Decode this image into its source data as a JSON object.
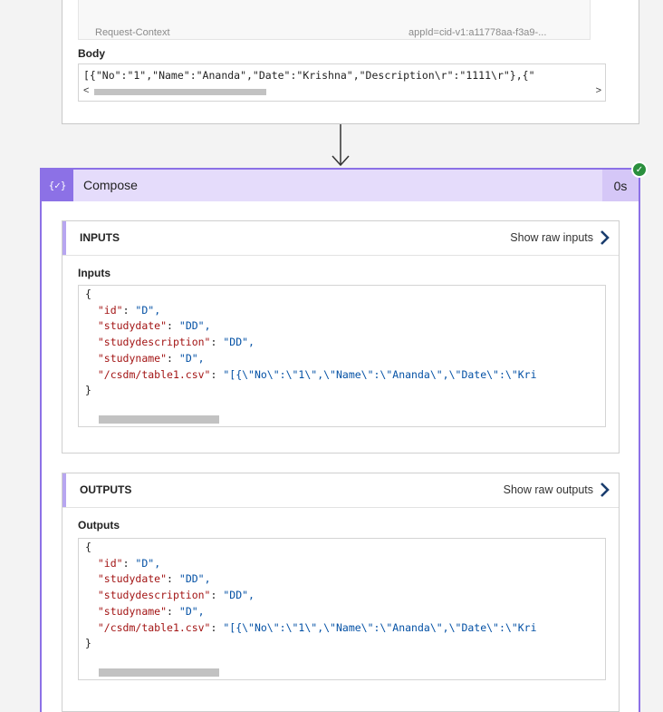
{
  "http_step": {
    "header_key": "Request-Context",
    "header_value": "appId=cid-v1:a11778aa-f3a9-...",
    "body_label": "Body",
    "body_text": "[{\"No\":\"1\",\"Name\":\"Ananda\",\"Date\":\"Krishna\",\"Description\\r\":\"1111\\r\"},{\""
  },
  "compose": {
    "icon_text": "{✓}",
    "title": "Compose",
    "duration": "0s",
    "status_color": "#2a8f3d",
    "accent_color": "#8c71e6",
    "inputs": {
      "section_title": "INPUTS",
      "raw_label": "Show raw inputs",
      "sub_label": "Inputs"
    },
    "outputs": {
      "section_title": "OUTPUTS",
      "raw_label": "Show raw outputs",
      "sub_label": "Outputs"
    },
    "json_lines": [
      {
        "open": "{"
      },
      {
        "key": "\"id\"",
        "value": "\"D\","
      },
      {
        "key": "\"studydate\"",
        "value": "\"DD\","
      },
      {
        "key": "\"studydescription\"",
        "value": "\"DD\","
      },
      {
        "key": "\"studyname\"",
        "value": "\"D\","
      },
      {
        "key": "\"/csdm/table1.csv\"",
        "value": "\"[{\\\"No\\\":\\\"1\\\",\\\"Name\\\":\\\"Ananda\\\",\\\"Date\\\":\\\"Kri"
      },
      {
        "close": "}"
      }
    ],
    "json_open": "{",
    "json_close": "}",
    "line_id_key": "\"id\"",
    "line_id_val": "\"D\",",
    "line_date_key": "\"studydate\"",
    "line_date_val": "\"DD\",",
    "line_desc_key": "\"studydescription\"",
    "line_desc_val": "\"DD\",",
    "line_name_key": "\"studyname\"",
    "line_name_val": "\"D\",",
    "line_csv_key": "\"/csdm/table1.csv\"",
    "line_csv_val": "\"[{\\\"No\\\":\\\"1\\\",\\\"Name\\\":\\\"Ananda\\\",\\\"Date\\\":\\\"Kri"
  }
}
